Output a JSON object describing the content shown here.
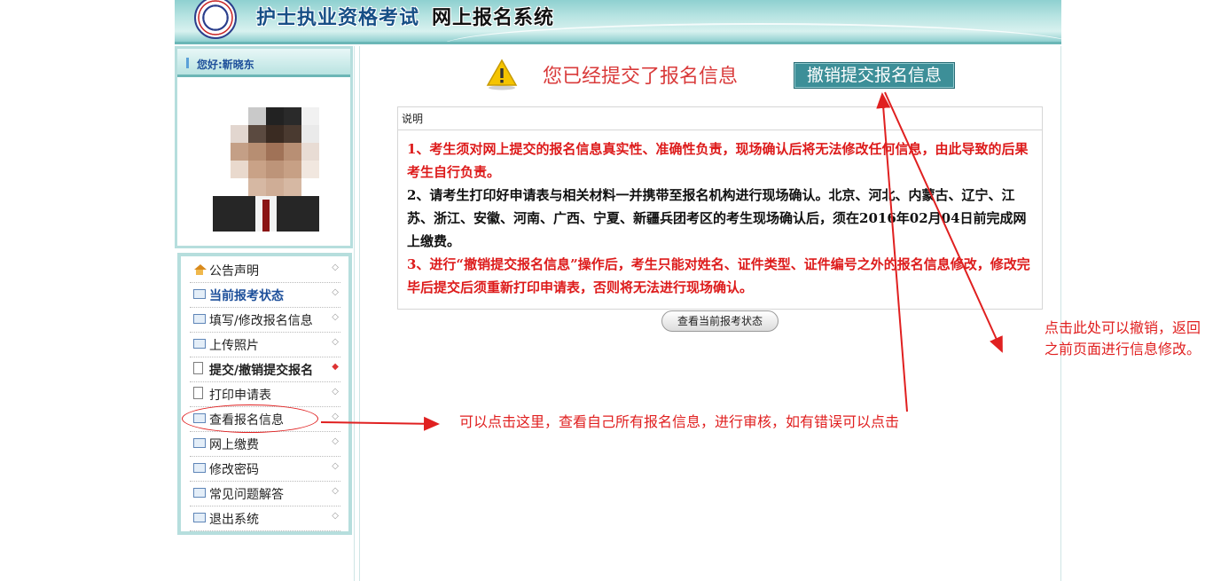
{
  "header": {
    "title": "护士执业资格考试",
    "subtitle": "网上报名系统"
  },
  "user": {
    "greeting": "您好:靳晓东"
  },
  "menu": {
    "items": [
      {
        "label": "公告声明",
        "icon": "home-icon"
      },
      {
        "label": "当前报考状态",
        "icon": "card-icon"
      },
      {
        "label": "填写/修改报名信息",
        "icon": "card-icon"
      },
      {
        "label": "上传照片",
        "icon": "card-icon"
      },
      {
        "label": "提交/撤销提交报名",
        "icon": "document-icon"
      },
      {
        "label": "打印申请表",
        "icon": "document-icon"
      },
      {
        "label": "查看报名信息",
        "icon": "card-icon"
      },
      {
        "label": "网上缴费",
        "icon": "card-icon"
      },
      {
        "label": "修改密码",
        "icon": "card-icon"
      },
      {
        "label": "常见问题解答",
        "icon": "card-icon"
      },
      {
        "label": "退出系统",
        "icon": "card-icon"
      }
    ]
  },
  "main": {
    "status_message": "您已经提交了报名信息",
    "revoke_button": "撤销提交报名信息",
    "info_title": "说明",
    "paragraphs": [
      "1、考生须对网上提交的报名信息真实性、准确性负责，现场确认后将无法修改任何信息，由此导致的后果考生自行负责。",
      "2、请考生打印好申请表与相关材料一并携带至报名机构进行现场确认。北京、河北、内蒙古、辽宁、江苏、浙江、安徽、河南、广西、宁夏、新疆兵团考区的考生现场确认后，须在2016年02月04日前完成网上缴费。",
      "3、进行“撤销提交报名信息”操作后，考生只能对姓名、证件类型、证件编号之外的报名信息修改，修改完毕后提交后须重新打印申请表，否则将无法进行现场确认。"
    ],
    "status_button": "查看当前报考状态"
  },
  "annotations": {
    "left_note": "可以点击这里，查看自己所有报名信息，进行审核，如有错误可以点击",
    "right_note": "点击此处可以撤销，返回之前页面进行信息修改。"
  },
  "colors": {
    "accent": "#3d8f98",
    "warning_text": "#d93a3a",
    "annotation": "#e02020",
    "frame": "#b6dedd"
  }
}
